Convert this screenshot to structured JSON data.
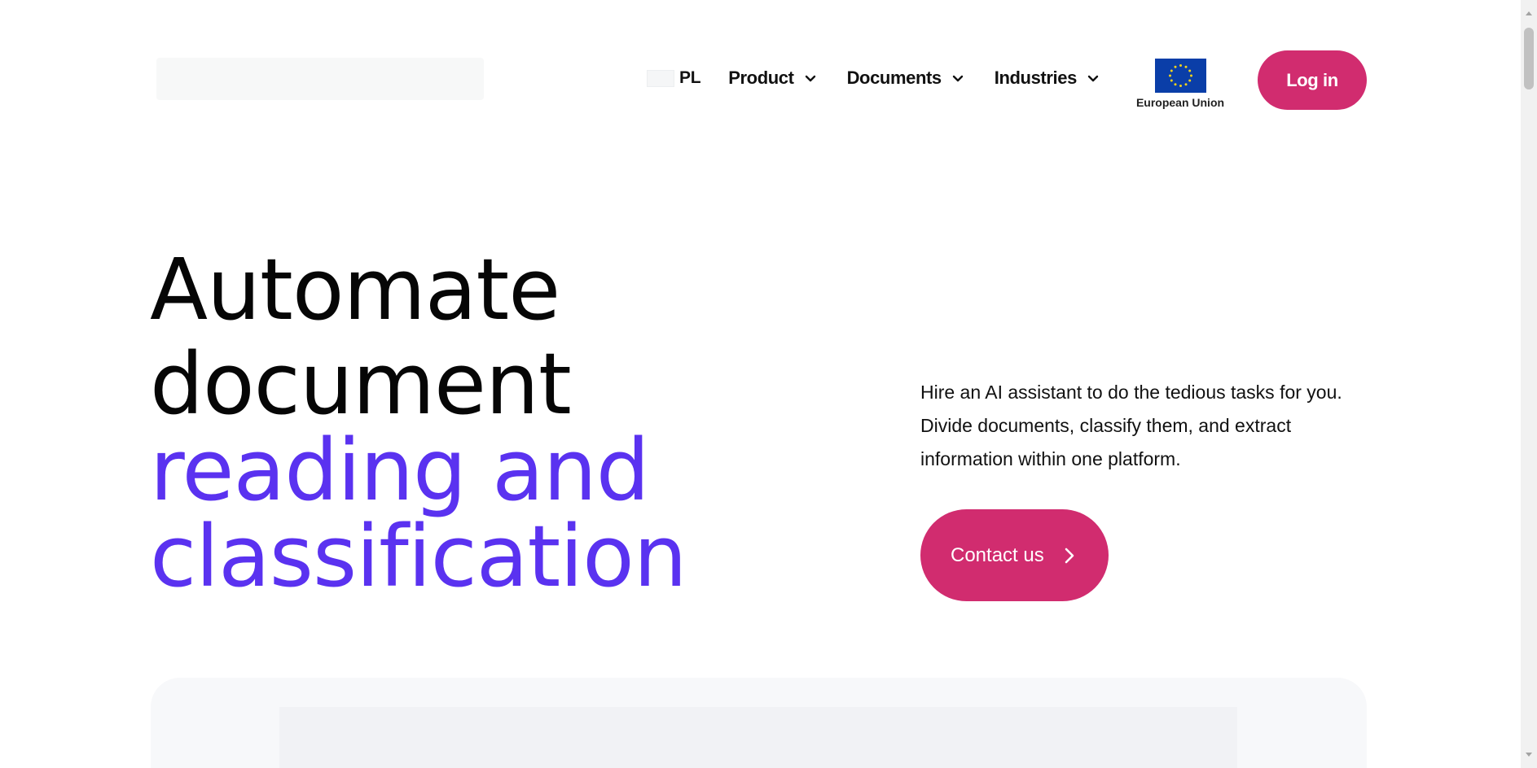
{
  "header": {
    "language": {
      "label": "PL"
    },
    "nav": [
      {
        "label": "Product",
        "icon": "chevron-down-icon"
      },
      {
        "label": "Documents",
        "icon": "chevron-down-icon"
      },
      {
        "label": "Industries",
        "icon": "chevron-down-icon"
      }
    ],
    "eu_badge": {
      "label": "European Union",
      "icon": "eu-flag-icon"
    },
    "login_label": "Log in"
  },
  "hero": {
    "title_lines": [
      "Automate",
      "document",
      "reading and",
      "classification"
    ],
    "description": "Hire an AI assistant to do the tedious tasks for you. Divide documents, classify them, and extract information within one platform.",
    "cta": {
      "label": "Contact us",
      "icon": "chevron-right-icon"
    }
  },
  "colors": {
    "brand_pink": "#d12c6f",
    "accent_purple": "#5a32f0",
    "text_dark": "#060606",
    "eu_blue": "#0a3ea8",
    "eu_gold": "#f2d21d"
  }
}
